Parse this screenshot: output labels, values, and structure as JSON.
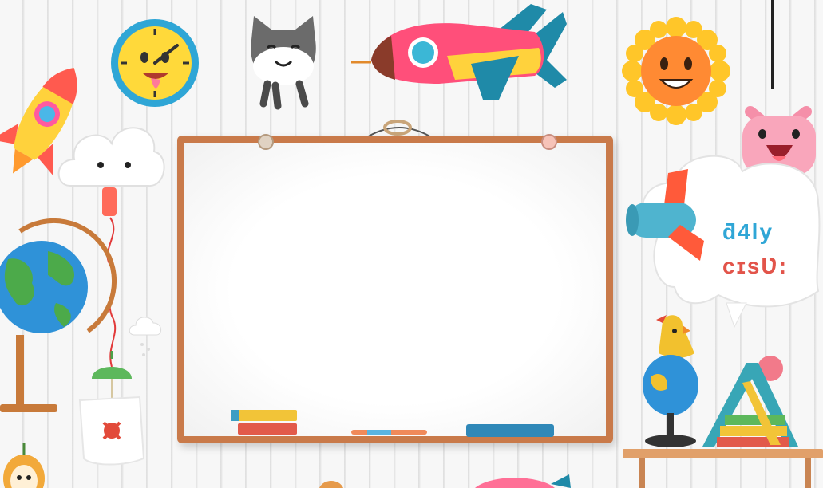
{
  "scene": {
    "wall_color": "#f7f7f7",
    "plank_line_color": "#dedede",
    "board_frame_color": "#c97a4a",
    "board_surface_color": "#ffffff"
  },
  "whiteboard": {
    "message": "",
    "tray_items": [
      "book-stack",
      "marker",
      "eraser"
    ]
  },
  "decorations": [
    "rocket-icon",
    "clock-icon",
    "cat-icon",
    "airplane-icon",
    "sun-icon",
    "cloud-icon",
    "globe-icon",
    "hanging-lamp-icon",
    "jar-icon",
    "pig-icon",
    "airplane-icon",
    "speech-cloud-icon",
    "bird-icon",
    "book-tent-icon",
    "shelf"
  ],
  "cloud_letters": {
    "line1": "ƌ4ly",
    "line2": "cɪsƲ:"
  }
}
